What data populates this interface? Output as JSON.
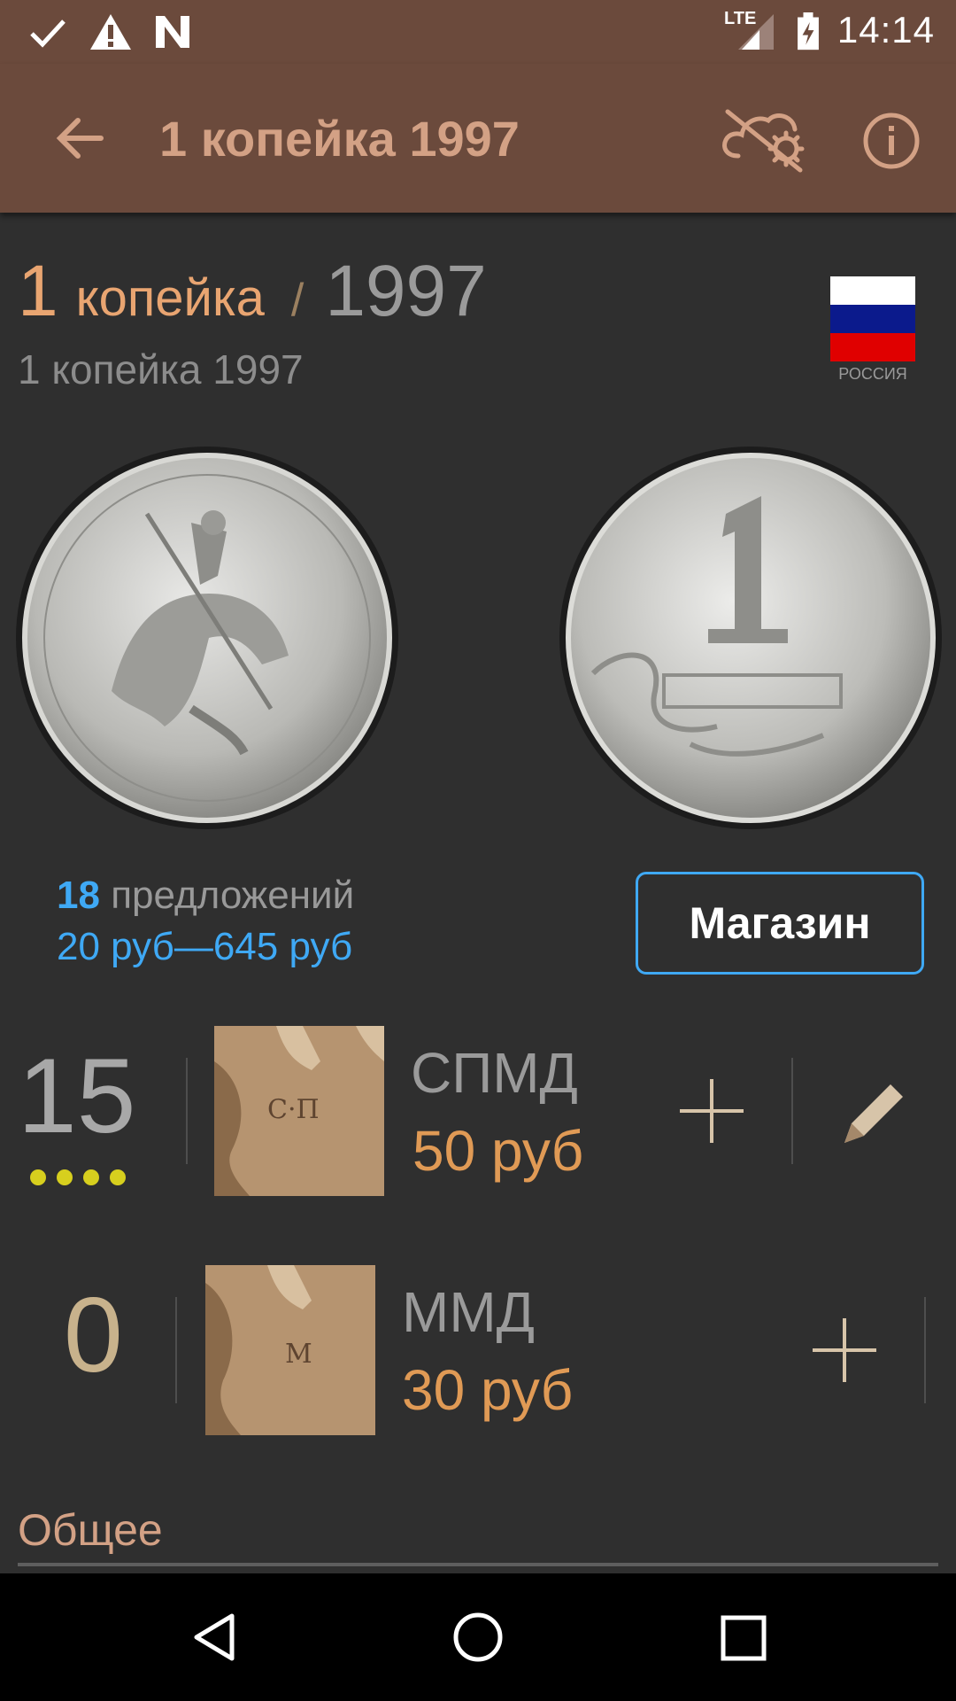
{
  "status_bar": {
    "time": "14:14",
    "network": "LTE",
    "icons": [
      "check-icon",
      "warning-icon",
      "n-icon",
      "signal-lte-icon",
      "battery-charging-icon"
    ]
  },
  "app_bar": {
    "title": "1 копейка 1997",
    "icons": [
      "back-arrow-icon",
      "cloud-settings-icon",
      "info-icon"
    ]
  },
  "coin": {
    "denomination": "1",
    "unit": "копейка",
    "separator": "/",
    "year": "1997",
    "subtitle": "1 копейка 1997",
    "country_label": "РОССИЯ",
    "flag_colors": [
      "#ffffff",
      "#0b1a8c",
      "#e00000"
    ]
  },
  "offers": {
    "count": "18",
    "label": "предложений",
    "price_range": "20 руб—645 руб",
    "shop_button": "Магазин"
  },
  "mints": [
    {
      "count": "15",
      "name": "СПМД",
      "price": "50 руб",
      "mark_letters": "С·П",
      "dots": 4
    },
    {
      "count": "0",
      "name": "ММД",
      "price": "30 руб",
      "mark_letters": "М",
      "dots": 0
    }
  ],
  "section": {
    "title": "Общее"
  },
  "colors": {
    "header": "#6b4a3c",
    "accent": "#e9a571",
    "link": "#3fa9f5",
    "background": "#2f2f2f"
  },
  "nav_bar": {
    "icons": [
      "back-triangle-icon",
      "home-circle-icon",
      "recents-square-icon"
    ]
  }
}
